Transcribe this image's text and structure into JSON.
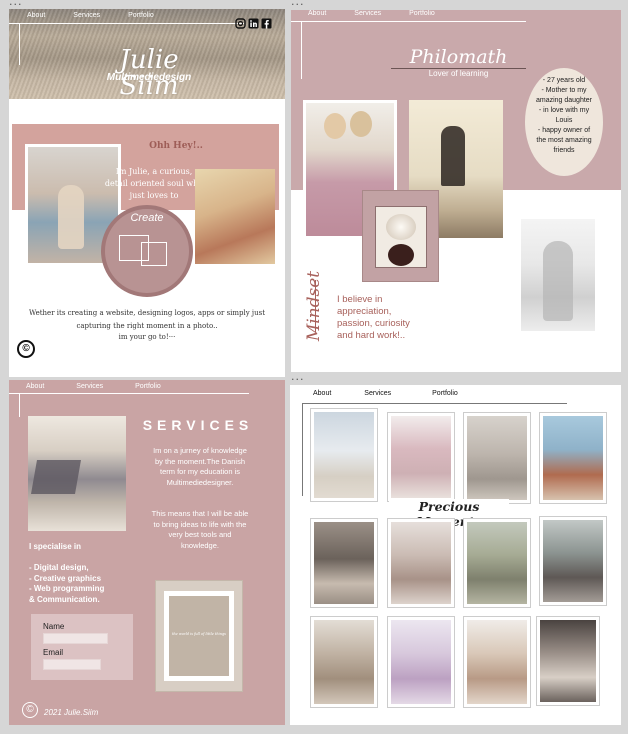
{
  "nav": {
    "about": "About",
    "services": "Services",
    "portfolio": "Portfolio"
  },
  "panel1": {
    "logo_name": "Julie Siim",
    "logo_sub": "Multimediedesign",
    "social": [
      "instagram",
      "linkedin",
      "facebook"
    ],
    "greeting": "Ohh Hey!..",
    "intro": "Im Julie, a curious, detail oriented soul who just loves to",
    "create_label": "Create",
    "body_text": "Wether its creating a website, designing logos, apps or simply just capturing the right moment in a photo..",
    "body_text2": "im your go to!···",
    "copyright_symbol": "©"
  },
  "panel2": {
    "title": "Philomath",
    "subtitle": "Lover of learning",
    "facts": "- 27 years old\n- Mother to my amazing daughter\n- in love with my Louis\n- happy owner of the most amazing friends",
    "mindset_word": "Mindset",
    "mindset_text": "I believe in appreciation, passion, curiosity and hard work!.."
  },
  "panel3": {
    "heading": "SERVICES",
    "paragraph1": "Im on a jurney of knowledge by the moment.The Danish term for my education is Multimediedesigner.",
    "paragraph2": "This means that I will be able to bring ideas to life with the very best tools and knowledge.",
    "specialise_heading": "I specialise in",
    "specialise_items": [
      "- Digital design,",
      "- Creative graphics",
      "- Web programming",
      "& Communication."
    ],
    "name_label": "Name",
    "email_label": "Email",
    "frame_script": "the world is full of little things",
    "footer": "2021 Julie.Siim",
    "copyright_symbol": "©"
  },
  "panel4": {
    "title": "Precious Moments"
  },
  "colors": {
    "mauve": "#c9a4a4",
    "rose": "#d3a39d",
    "cream": "#efe6dc",
    "text_rose": "#a8615b"
  }
}
